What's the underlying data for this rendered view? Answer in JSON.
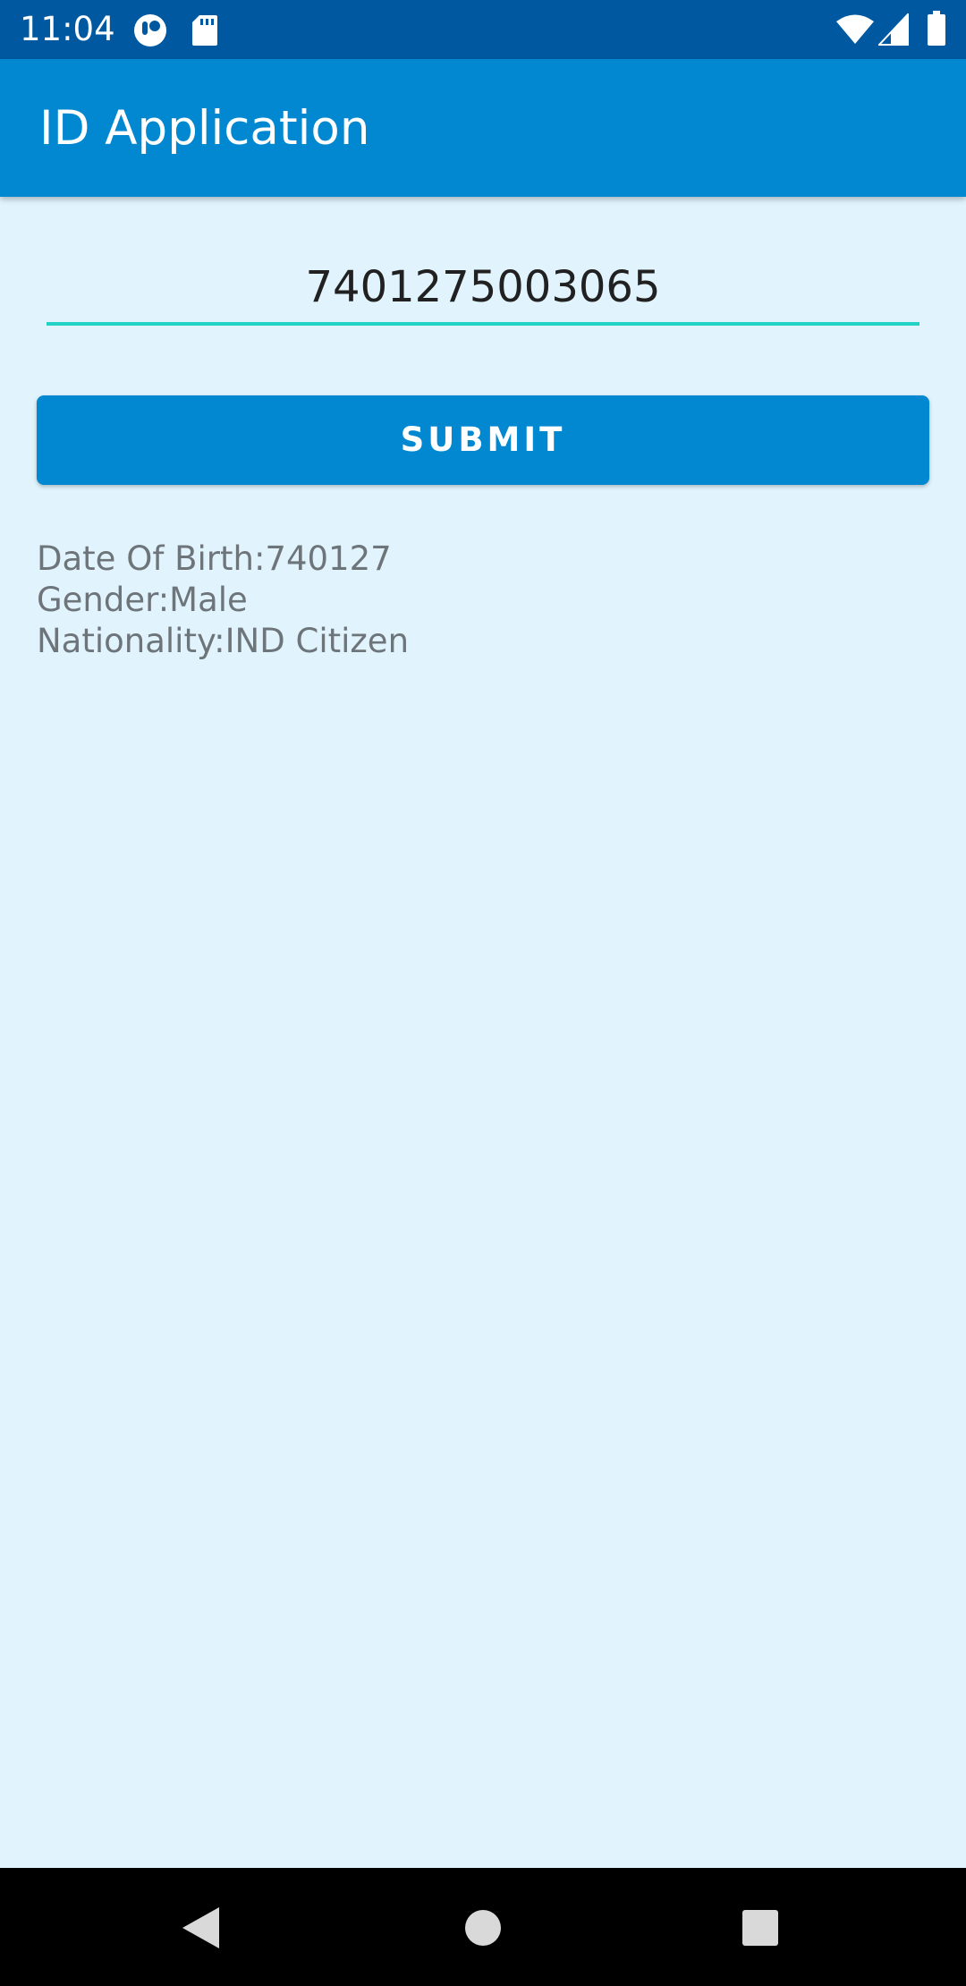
{
  "status_bar": {
    "time": "11:04",
    "left_icons": [
      "app-notification-icon",
      "sd-card-icon"
    ],
    "right_icons": [
      "wifi-icon",
      "cell-signal-icon",
      "battery-icon"
    ]
  },
  "app_bar": {
    "title": "ID Application"
  },
  "form": {
    "id_number": "7401275003065",
    "submit_label": "SUBMIT"
  },
  "result": {
    "dob": "Date Of Birth:740127",
    "gender": "Gender:Male",
    "nationality": "Nationality:IND Citizen"
  },
  "nav_bar": {
    "buttons": [
      "back-icon",
      "home-icon",
      "recents-icon"
    ]
  },
  "colors": {
    "status_bar": "#0059a0",
    "app_bar": "#0288d1",
    "background": "#e1f4fd",
    "accent_underline": "#22d3c5",
    "result_text": "#6e757a"
  }
}
